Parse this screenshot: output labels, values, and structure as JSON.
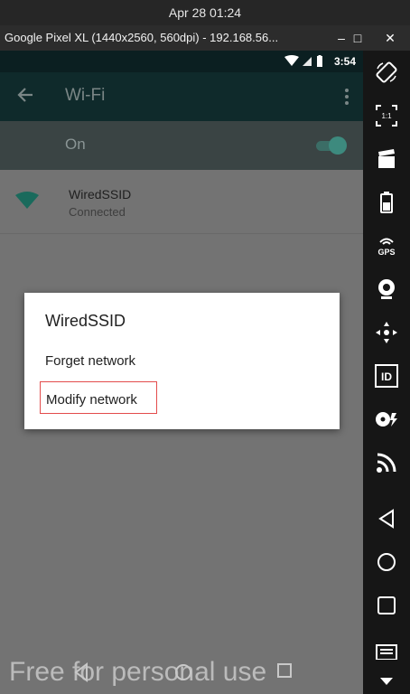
{
  "host_clock": "Apr 28  01:24",
  "window": {
    "title": "Google Pixel XL (1440x2560, 560dpi) - 192.168.56...",
    "minimize_glyph": "–",
    "maximize_glyph": "□",
    "close_glyph": "✕"
  },
  "status_bar": {
    "time": "3:54"
  },
  "app_bar": {
    "title": "Wi-Fi"
  },
  "wifi_toggle": {
    "label": "On",
    "state": "on"
  },
  "network": {
    "ssid": "WiredSSID",
    "status": "Connected"
  },
  "dialog": {
    "title": "WiredSSID",
    "options": [
      "Forget network",
      "Modify network"
    ],
    "highlighted_option": "Modify network"
  },
  "watermark": "Free for personal use",
  "sidebar_tools": [
    "rotate-icon",
    "scale-1to1-icon",
    "screen-record-icon",
    "battery-icon",
    "gps-icon",
    "camera-icon",
    "dpad-icon",
    "device-id-icon",
    "media-icon",
    "cast-icon",
    "back-nav-icon",
    "home-nav-icon",
    "recents-nav-icon",
    "menu-icon",
    "scroll-down-icon"
  ],
  "sidebar_labels": {
    "gps": "GPS",
    "id": "ID",
    "scale": "1:1"
  },
  "colors": {
    "accent_teal": "#1f7a6a",
    "highlight_border": "#e34c4c"
  }
}
